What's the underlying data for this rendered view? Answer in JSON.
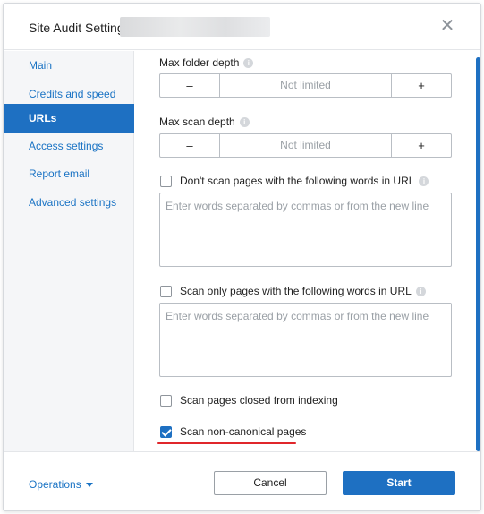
{
  "header": {
    "title": "Site Audit Settings"
  },
  "sidebar": {
    "items": [
      {
        "label": "Main"
      },
      {
        "label": "Credits and speed"
      },
      {
        "label": "URLs"
      },
      {
        "label": "Access settings"
      },
      {
        "label": "Report email"
      },
      {
        "label": "Advanced settings"
      }
    ],
    "active_index": 2
  },
  "content": {
    "max_folder_depth": {
      "label": "Max folder depth",
      "value": "Not limited",
      "minus": "–",
      "plus": "+"
    },
    "max_scan_depth": {
      "label": "Max scan depth",
      "value": "Not limited",
      "minus": "–",
      "plus": "+"
    },
    "exclude_words": {
      "label": "Don't scan pages with the following words in URL",
      "checked": false,
      "placeholder": "Enter words separated by commas or from the new line"
    },
    "include_words": {
      "label": "Scan only pages with the following words in URL",
      "checked": false,
      "placeholder": "Enter words separated by commas or from the new line"
    },
    "closed_from_indexing": {
      "label": "Scan pages closed from indexing",
      "checked": false
    },
    "non_canonical": {
      "label": "Scan non-canonical pages",
      "checked": true
    }
  },
  "footer": {
    "operations_label": "Operations",
    "cancel_label": "Cancel",
    "start_label": "Start"
  },
  "icons": {
    "close": "close-icon",
    "info": "info-icon",
    "caret": "chevron-down-icon"
  },
  "colors": {
    "accent": "#1e70c2",
    "link": "#1a73c4",
    "highlight_underline": "#e0262b"
  }
}
